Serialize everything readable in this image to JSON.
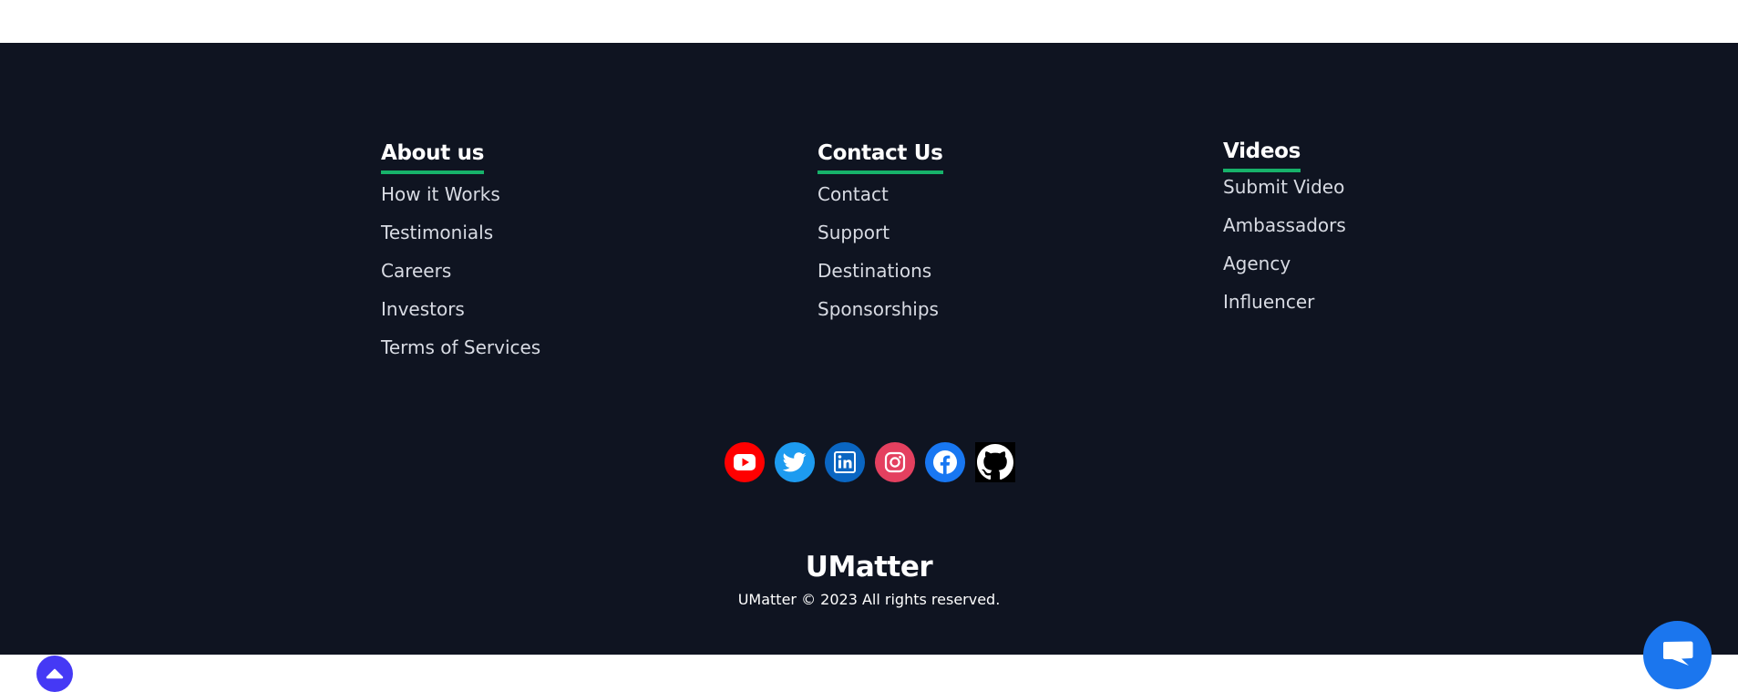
{
  "footer": {
    "columns": [
      {
        "heading": "About us",
        "links": [
          "How it Works",
          "Testimonials",
          "Careers",
          "Investors",
          "Terms of Services"
        ]
      },
      {
        "heading": "Contact Us",
        "links": [
          "Contact",
          "Support",
          "Destinations",
          "Sponsorships"
        ]
      },
      {
        "heading": "Videos",
        "links": [
          "Submit Video",
          "Ambassadors",
          "Agency",
          "Influencer"
        ]
      }
    ],
    "social": [
      {
        "icon": "youtube-icon",
        "color": "#ff0000"
      },
      {
        "icon": "twitter-icon",
        "color": "#1d9bf0"
      },
      {
        "icon": "linkedin-icon",
        "color": "#0a66c2"
      },
      {
        "icon": "instagram-icon",
        "color": "#e4405f"
      },
      {
        "icon": "facebook-icon",
        "color": "#1877f2"
      },
      {
        "icon": "github-icon",
        "color": "#000000"
      }
    ],
    "brand": "UMatter",
    "copyright": "UMatter © 2023 All rights reserved.",
    "accent_color": "#17b26a",
    "background_color": "#0f1421"
  },
  "widgets": {
    "scroll_top": {
      "icon": "chevron-up-icon",
      "color": "#4539f5"
    },
    "chat": {
      "icon": "chat-bubble-icon",
      "color": "#1b76ee"
    }
  }
}
